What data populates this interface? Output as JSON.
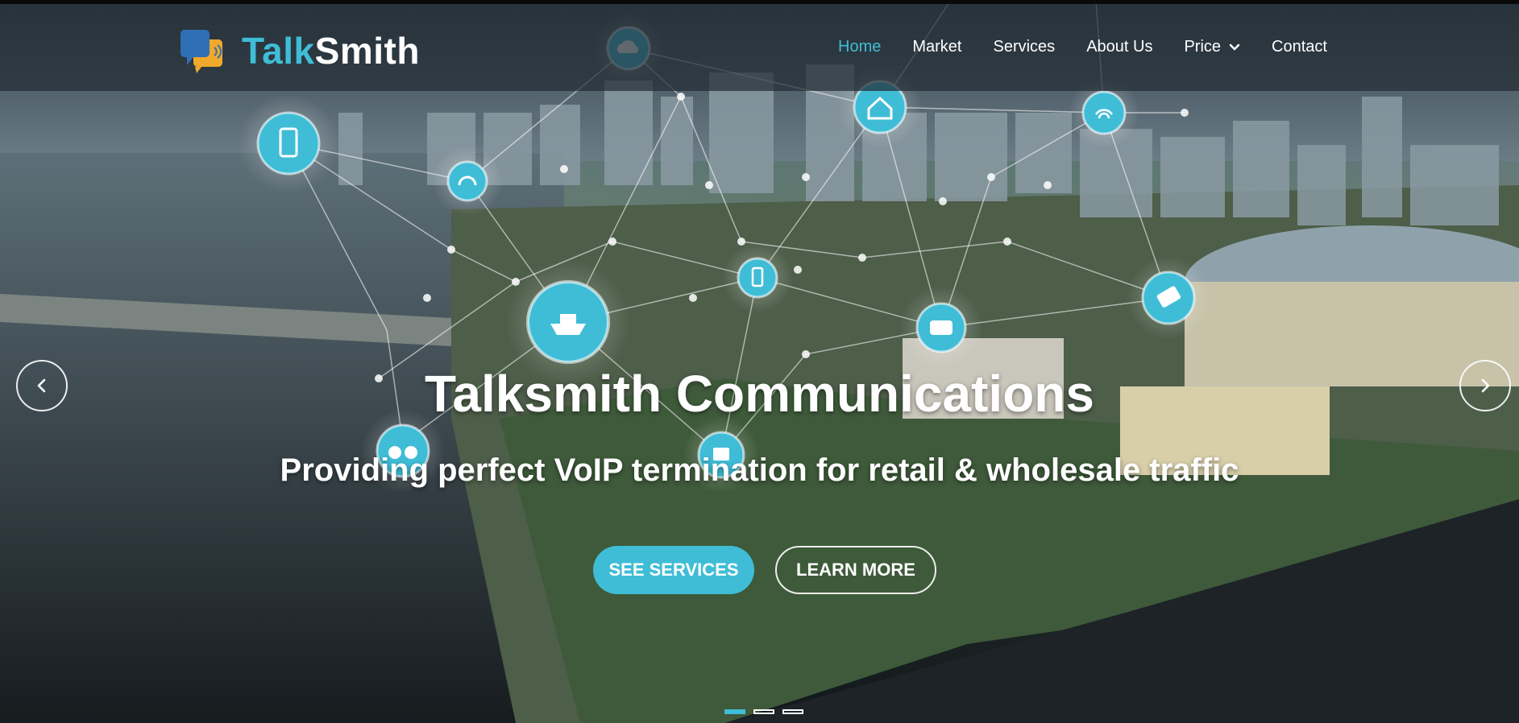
{
  "brand": {
    "name_part1": "Talk",
    "name_part2": "Smith",
    "accent_color": "#3fbdd6",
    "logo_icon": "chat-bubbles-icon"
  },
  "nav": {
    "items": [
      {
        "label": "Home",
        "active": true
      },
      {
        "label": "Market",
        "active": false
      },
      {
        "label": "Services",
        "active": false
      },
      {
        "label": "About Us",
        "active": false
      },
      {
        "label": "Price",
        "active": false,
        "dropdown": true
      },
      {
        "label": "Contact",
        "active": false
      }
    ]
  },
  "hero": {
    "title": "Talksmith Communications",
    "subtitle": "Providing perfect VoIP termination for retail & wholesale traffic",
    "primary_button": "SEE SERVICES",
    "secondary_button": "LEARN MORE",
    "prev_icon": "chevron-left-icon",
    "next_icon": "chevron-right-icon"
  },
  "slider": {
    "slide_count": 3,
    "active_slide": 1
  },
  "network_icons": [
    "smartphone-icon",
    "cloud-icon",
    "home-icon",
    "wifi-icon",
    "headset-icon",
    "ship-icon",
    "mobile-icon",
    "train-icon",
    "ticket-icon",
    "binoculars-icon",
    "tablet-icon"
  ]
}
